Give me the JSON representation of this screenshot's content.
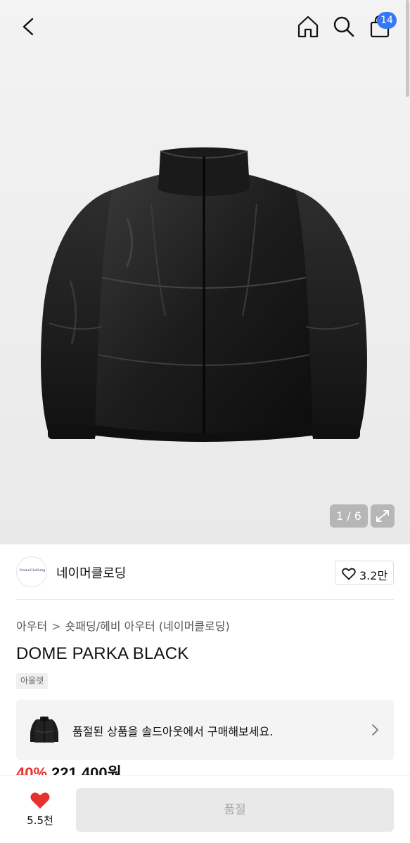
{
  "header": {
    "cart_count": "14",
    "icons": [
      "back-icon",
      "home-icon",
      "search-icon",
      "shopping-bag-icon"
    ]
  },
  "gallery": {
    "counter": "1 / 6"
  },
  "brand": {
    "logo_text": "NameClothing",
    "name": "네이머클로딩",
    "likes": "3.2만"
  },
  "breadcrumb": {
    "items": [
      "아우터",
      "숏패딩/헤비 아우터 (네이머클로딩)"
    ]
  },
  "product": {
    "title": "DOME PARKA BLACK",
    "tag": "아울렛",
    "discount": "40%",
    "price": "221,400원"
  },
  "soldout_banner": {
    "text": "품절된 상품을 솔드아웃에서 구매해보세요."
  },
  "bottom": {
    "wish_count": "5.5천",
    "buy_label": "품절"
  },
  "colors": {
    "badge": "#3478f6",
    "discount": "#e8312c",
    "heart": "#e8312c"
  }
}
